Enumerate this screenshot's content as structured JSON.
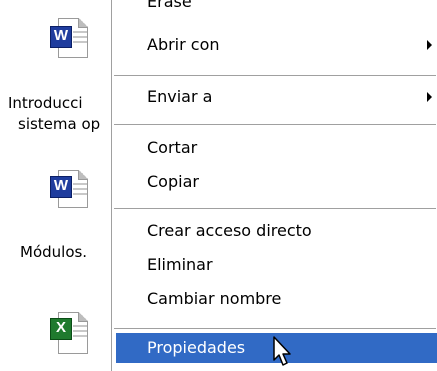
{
  "desktop": {
    "icons": [
      {
        "label": "",
        "badge": "W",
        "app": "word"
      },
      {
        "label": "Introducci",
        "label2": "sistema op",
        "badge": "W",
        "app": "word"
      },
      {
        "label": "Módulos.",
        "badge": "W",
        "app": "word"
      },
      {
        "label": "",
        "badge": "X",
        "app": "excel"
      }
    ]
  },
  "context_menu": {
    "items": [
      {
        "label": "Erase",
        "submenu": false,
        "selected": false
      },
      {
        "label": "Abrir con",
        "submenu": true,
        "selected": false
      },
      {
        "label": "Enviar a",
        "submenu": true,
        "selected": false
      },
      {
        "label": "Cortar",
        "submenu": false,
        "selected": false
      },
      {
        "label": "Copiar",
        "submenu": false,
        "selected": false
      },
      {
        "label": "Crear acceso directo",
        "submenu": false,
        "selected": false
      },
      {
        "label": "Eliminar",
        "submenu": false,
        "selected": false
      },
      {
        "label": "Cambiar nombre",
        "submenu": false,
        "selected": false
      },
      {
        "label": "Propiedades",
        "submenu": false,
        "selected": true
      }
    ]
  },
  "colors": {
    "selection": "#316ac5",
    "word_badge": "#1f3d9e",
    "excel_badge": "#1f7a2e"
  },
  "icons": [
    "word-file-icon",
    "excel-file-icon",
    "submenu-arrow-icon",
    "mouse-pointer-icon"
  ]
}
